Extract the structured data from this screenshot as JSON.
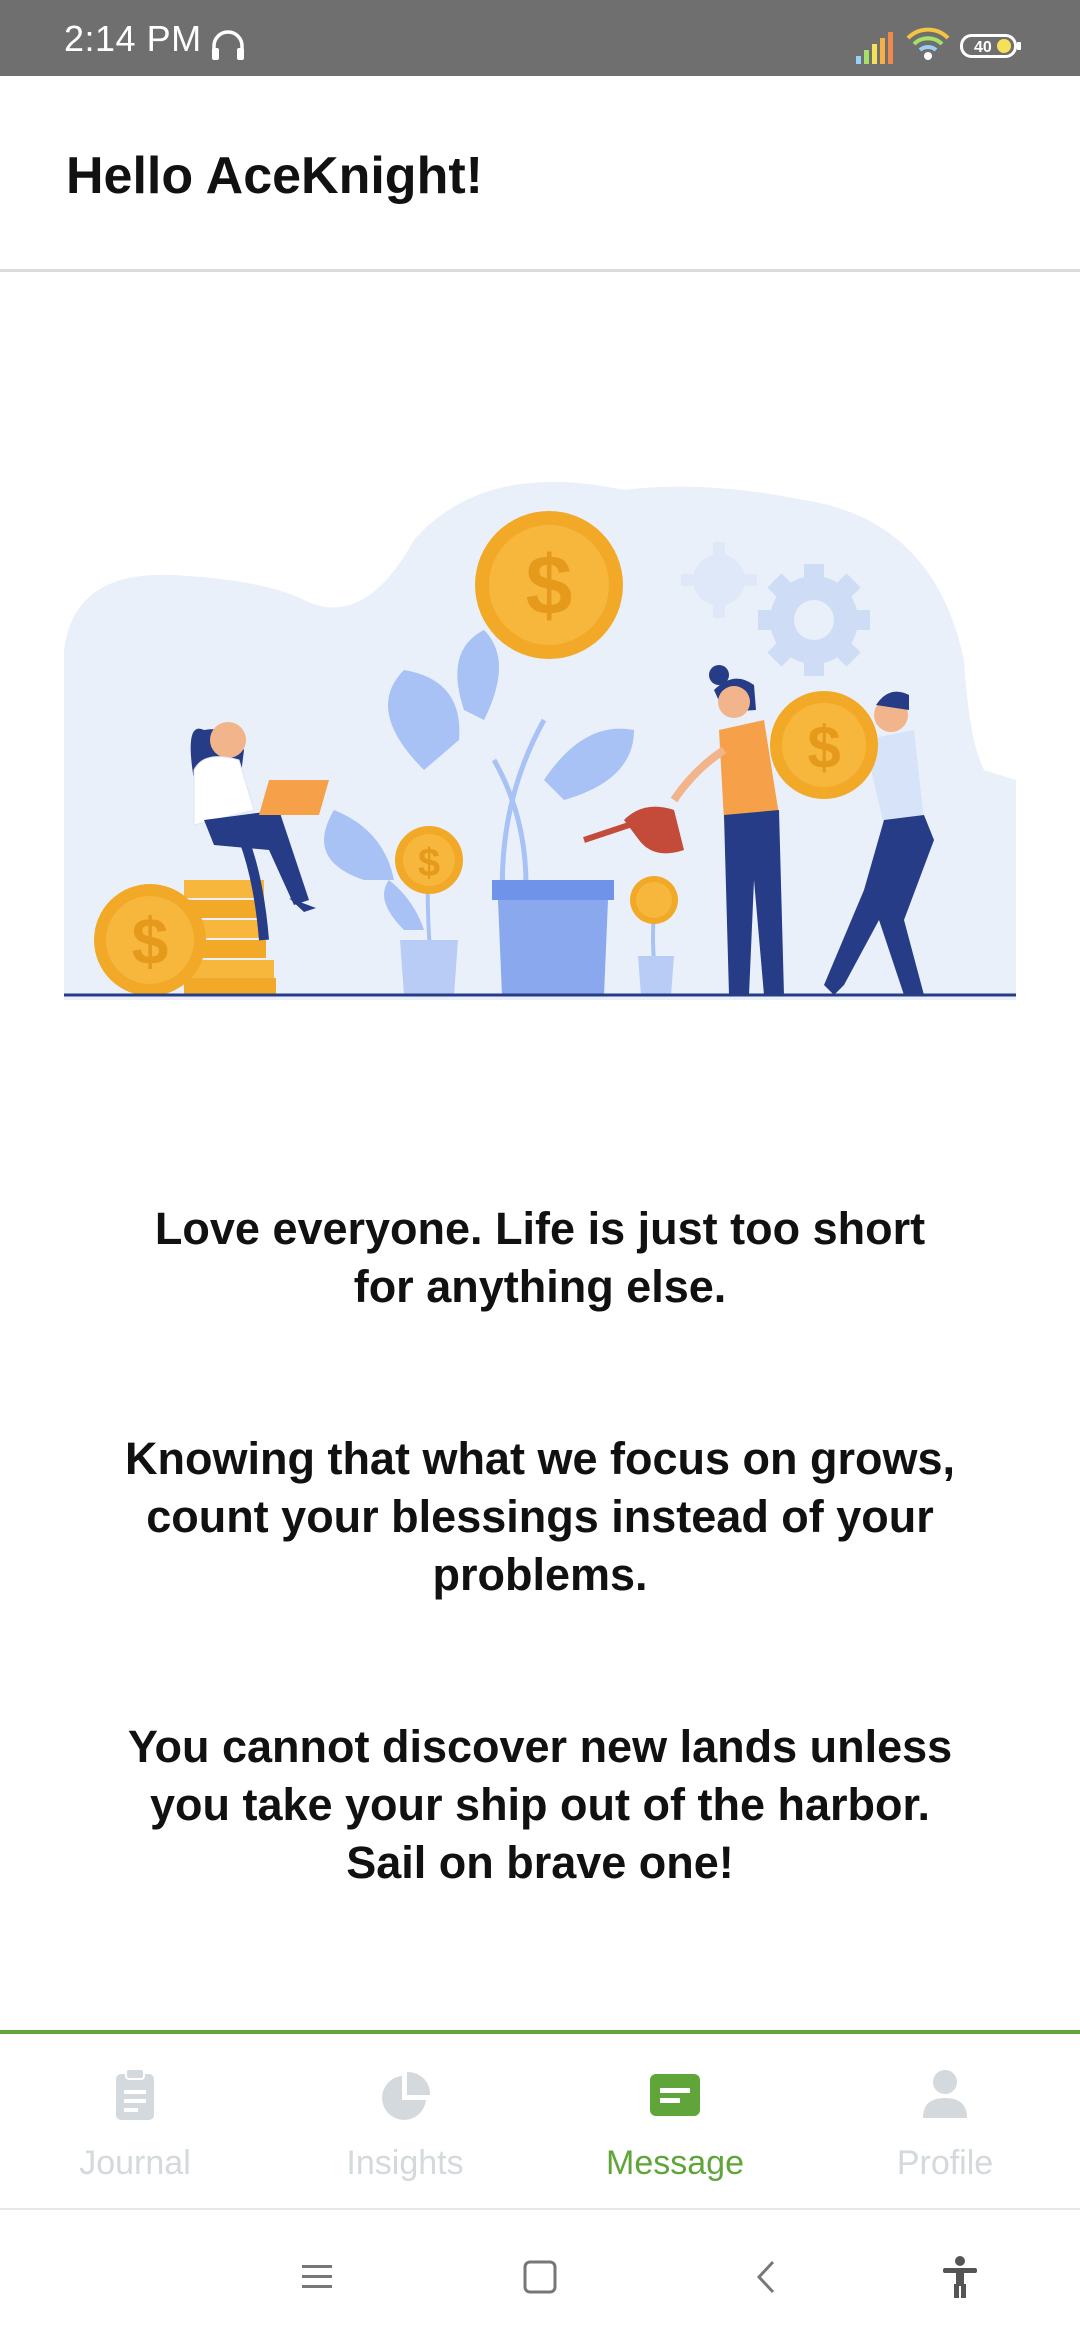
{
  "status_bar": {
    "time": "2:14 PM",
    "battery_level": "40",
    "icons": [
      "headset-icon",
      "signal-icon",
      "wifi-icon",
      "battery-icon"
    ]
  },
  "header": {
    "greeting": "Hello AceKnight!"
  },
  "illustration": {
    "dollar_sign": "$",
    "colors": {
      "background_blob": "#eaf0fa",
      "coin": "#f6b73c",
      "plant": "#a9c2f5",
      "pot": "#6f93e8",
      "figure_dark": "#263c86"
    }
  },
  "quotes": [
    "Love everyone. Life is just too short for anything else.",
    "Knowing that what we focus on grows, count your blessings instead of your problems.",
    "You cannot discover new lands unless you take your ship out of the harbor. Sail on brave one!"
  ],
  "bottom_nav": {
    "items": [
      {
        "label": "Journal",
        "icon": "clipboard-icon",
        "active": false
      },
      {
        "label": "Insights",
        "icon": "pie-chart-icon",
        "active": false
      },
      {
        "label": "Message",
        "icon": "message-icon",
        "active": true
      },
      {
        "label": "Profile",
        "icon": "person-icon",
        "active": false
      }
    ],
    "colors": {
      "active": "#5fa53a",
      "inactive": "#d3d9dc"
    }
  },
  "system_nav": {
    "buttons": [
      "menu-icon",
      "home-icon",
      "back-icon",
      "accessibility-icon"
    ]
  }
}
